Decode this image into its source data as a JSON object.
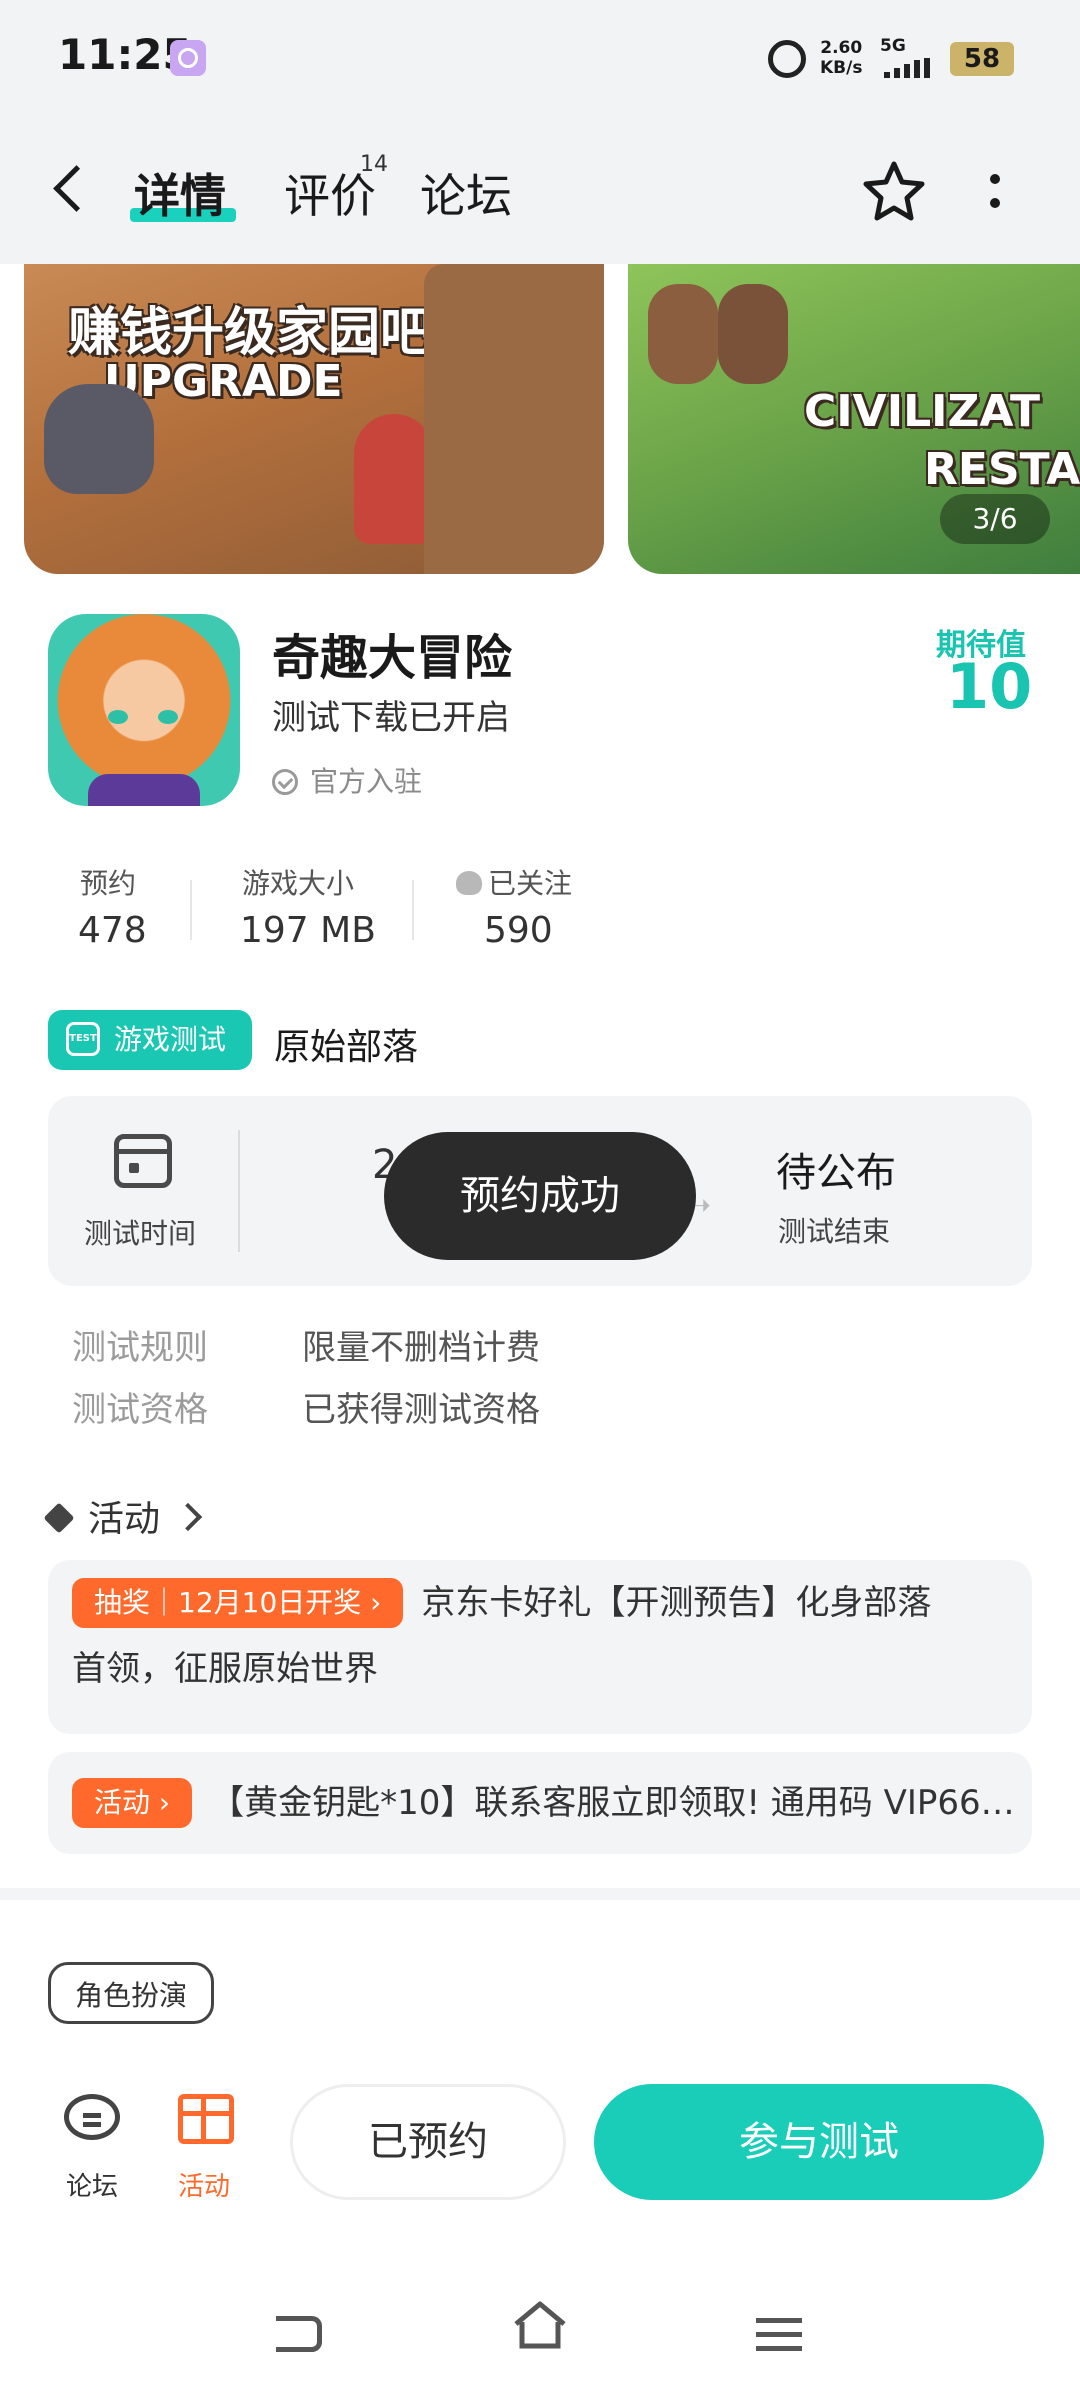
{
  "status": {
    "time": "11:25",
    "speed_top": "2.60",
    "speed_bottom": "KB/s",
    "network": "5G",
    "battery": "58"
  },
  "header": {
    "tabs": [
      {
        "label": "详情"
      },
      {
        "label": "评价"
      },
      {
        "label": "论坛"
      }
    ],
    "review_badge": "14"
  },
  "gallery": {
    "shot1_title": "赚钱升级家园吧!",
    "shot1_sub": "UPGRADE",
    "shot2_title": "CIVILIZAT",
    "shot2_sub": "RESTA",
    "counter": "3/6"
  },
  "app": {
    "name": "奇趣大冒险",
    "subtitle": "测试下载已开启",
    "official": "官方入驻",
    "expect_label": "期待值",
    "expect_value": "10"
  },
  "stats": [
    {
      "label": "预约",
      "value": "478"
    },
    {
      "label": "游戏大小",
      "value": "197 MB"
    },
    {
      "label": "已关注",
      "value": "590"
    }
  ],
  "test": {
    "badge": "游戏测试",
    "badge_icon": "TEST",
    "name": "原始部落",
    "time_label": "测试时间",
    "partial": "2",
    "end_value": "待公布",
    "end_label": "测试结束",
    "rules": [
      {
        "label": "测试规则",
        "value": "限量不删档计费"
      },
      {
        "label": "测试资格",
        "value": "已获得测试资格"
      }
    ]
  },
  "toast": "预约成功",
  "activities": {
    "title": "活动",
    "items": [
      {
        "tag": "抽奖｜12月10日开奖 ›",
        "text_line1": "京东卡好礼【开测预告】化身部落",
        "text_line2": "首领，征服原始世界"
      },
      {
        "tag": "活动 ›",
        "text_line1": "【黄金钥匙*10】联系客服立即领取! 通用码 VIP66…"
      }
    ]
  },
  "genre": "角色扮演",
  "bottom": {
    "forum_label": "论坛",
    "activity_label": "活动",
    "reserved_label": "已预约",
    "join_label": "参与测试"
  },
  "colors": {
    "accent": "#19cdb9",
    "orange": "#ff6a2c"
  }
}
